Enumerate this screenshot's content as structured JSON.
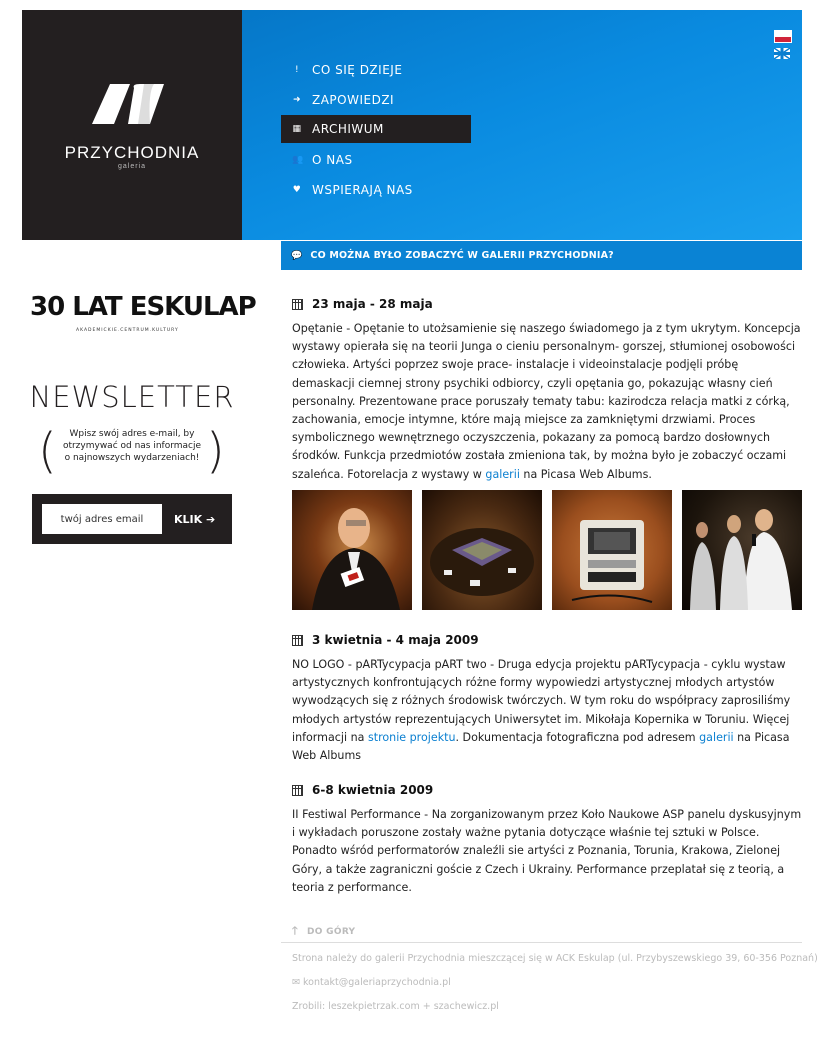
{
  "logo": {
    "name": "PRZYCHODNIA",
    "sub": "galeria"
  },
  "lang": {
    "pl_icon": "poland-flag-icon",
    "en_icon": "uk-flag-icon"
  },
  "nav": [
    {
      "icon": "!",
      "label": "CO SIĘ DZIEJE"
    },
    {
      "icon": "➜",
      "label": "ZAPOWIEDZI"
    },
    {
      "icon": "▦",
      "label": "ARCHIWUM",
      "active": true
    },
    {
      "icon": "👥",
      "label": "O NAS"
    },
    {
      "icon": "♥",
      "label": "WSPIERAJĄ NAS"
    }
  ],
  "subhead": "CO MOŻNA BYŁO ZOBACZYĆ W GALERII PRZYCHODNIA?",
  "eskulap": {
    "title": "30 LAT ESKULAP",
    "tagline": "AKADEMICKIE.CENTRUM.KULTURY"
  },
  "newsletter": {
    "title": "NEWSLETTER",
    "text": "Wpisz swój adres e-mail, by otrzymywać od nas informacje o najnowszych wydarzeniach!",
    "placeholder": "twój adres email",
    "button": "KLIK"
  },
  "entries": [
    {
      "date": "23 maja - 28 maja",
      "text_before": "Opętanie - Opętanie to utożsamienie się naszego świadomego ja z tym ukrytym. Koncepcja wystawy opierała się na teorii Junga o cieniu personalnym- gorszej, stłumionej osobowości człowieka. Artyści poprzez swoje prace- instalacje i videoinstalacje podjęli próbę demaskacji ciemnej strony psychiki odbiorcy, czyli opętania go, pokazując własny cień personalny. Prezentowane prace poruszały tematy tabu: kazirodcza relacja matki z córką, zachowania, emocje intymne, które mają miejsce za zamkniętymi drzwiami. Proces symbolicznego wewnętrznego oczyszczenia, pokazany za pomocą bardzo dosłownych środków. Funkcja przedmiotów została zmieniona tak, by można było je zobaczyć oczami szaleńca. Fotorelacja z wystawy w ",
      "link": "galerii",
      "text_after": " na Picasa Web Albums."
    },
    {
      "date": "3 kwietnia - 4 maja 2009",
      "text_before": "NO LOGO - pARTycypacja pART two - Druga edycja projektu pARTycypacja - cyklu wystaw artystycznych konfrontujących różne formy wypowiedzi artystycznej młodych artystów wywodzących się z różnych środowisk twórczych. W tym roku do współpracy zaprosiliśmy młodych artystów reprezentujących Uniwersytet im. Mikołaja Kopernika w Toruniu. Więcej informacji na ",
      "link": "stronie projektu",
      "text_mid": ". Dokumentacja fotograficzna pod adresem ",
      "link2": "galerii",
      "text_after": " na Picasa Web Albums"
    },
    {
      "date": "6-8 kwietnia 2009",
      "text": "II Festiwal Performance - Na zorganizowanym przez Koło Naukowe ASP panelu dyskusyjnym i wykładach poruszone zostały ważne pytania dotyczące właśnie tej sztuki w Polsce. Ponadto wśród performatorów znaleźli sie artyści z Poznania, Torunia, Krakowa, Zielonej Góry, a także zagraniczni goście z Czech i Ukrainy. Performance przeplatał się z teorią, a teoria z performance."
    }
  ],
  "footer": {
    "backtop": "DO GÓRY",
    "address": "Strona należy do galerii Przychodnia mieszczącej się w ACK Eskulap (ul. Przybyszewskiego 39, 60-356 Poznań)",
    "email": "kontakt@galeriaprzychodnia.pl",
    "credits": "Zrobili: leszekpietrzak.com + szachewicz.pl"
  }
}
